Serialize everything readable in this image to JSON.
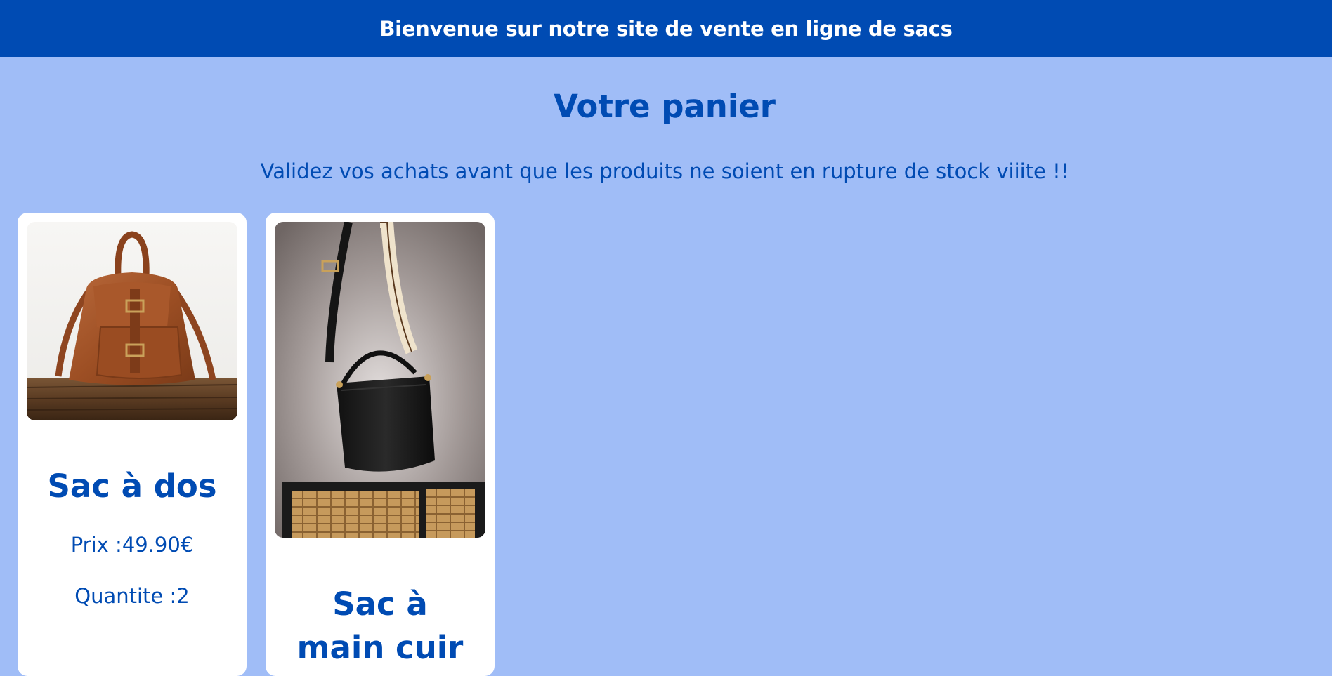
{
  "header": {
    "welcome": "Bienvenue sur notre site de vente en ligne de sacs"
  },
  "main": {
    "title": "Votre panier",
    "subtitle": "Validez vos achats avant que les produits ne soient en rupture de stock viiite !!"
  },
  "cart": {
    "items": [
      {
        "name": "Sac à dos",
        "price_label": "Prix :",
        "price": "49.90€",
        "quantity_label": "Quantite :",
        "quantity": "2"
      },
      {
        "name": "Sac à main cuir"
      }
    ]
  },
  "colors": {
    "brand_blue": "#004bb3",
    "page_background": "#a0bdf7",
    "card_background": "#ffffff"
  }
}
